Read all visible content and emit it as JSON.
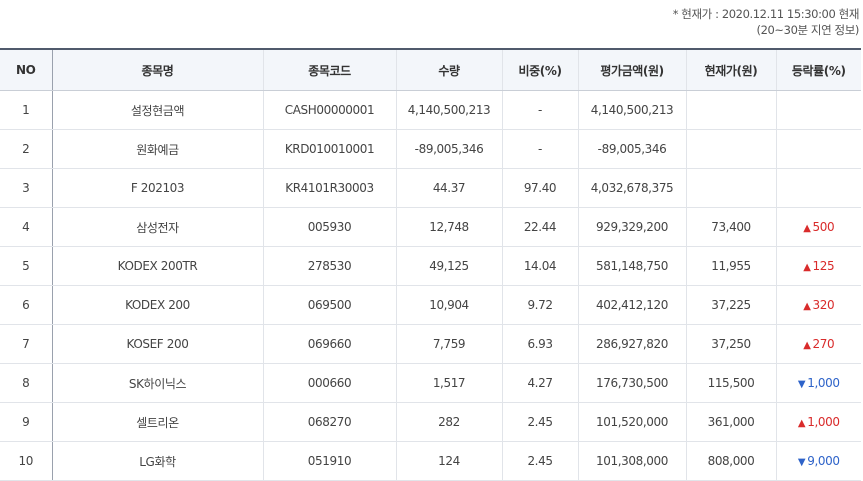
{
  "notice": {
    "line1": "* 현재가 : 2020.12.11 15:30:00 현재",
    "line2": "(20~30분 지연 정보)"
  },
  "columns": [
    "NO",
    "종목명",
    "종목코드",
    "수량",
    "비중(%)",
    "평가금액(원)",
    "현재가(원)",
    "등락률(%)"
  ],
  "rows": [
    {
      "no": "1",
      "name": "설정현금액",
      "code": "CASH00000001",
      "qty": "4,140,500,213",
      "weight": "-",
      "value": "4,140,500,213",
      "price": "",
      "change": "",
      "dir": ""
    },
    {
      "no": "2",
      "name": "원화예금",
      "code": "KRD010010001",
      "qty": "-89,005,346",
      "weight": "-",
      "value": "-89,005,346",
      "price": "",
      "change": "",
      "dir": ""
    },
    {
      "no": "3",
      "name": "F 202103",
      "code": "KR4101R30003",
      "qty": "44.37",
      "weight": "97.40",
      "value": "4,032,678,375",
      "price": "",
      "change": "",
      "dir": ""
    },
    {
      "no": "4",
      "name": "삼성전자",
      "code": "005930",
      "qty": "12,748",
      "weight": "22.44",
      "value": "929,329,200",
      "price": "73,400",
      "change": "500",
      "dir": "up"
    },
    {
      "no": "5",
      "name": "KODEX 200TR",
      "code": "278530",
      "qty": "49,125",
      "weight": "14.04",
      "value": "581,148,750",
      "price": "11,955",
      "change": "125",
      "dir": "up"
    },
    {
      "no": "6",
      "name": "KODEX 200",
      "code": "069500",
      "qty": "10,904",
      "weight": "9.72",
      "value": "402,412,120",
      "price": "37,225",
      "change": "320",
      "dir": "up"
    },
    {
      "no": "7",
      "name": "KOSEF 200",
      "code": "069660",
      "qty": "7,759",
      "weight": "6.93",
      "value": "286,927,820",
      "price": "37,250",
      "change": "270",
      "dir": "up"
    },
    {
      "no": "8",
      "name": "SK하이닉스",
      "code": "000660",
      "qty": "1,517",
      "weight": "4.27",
      "value": "176,730,500",
      "price": "115,500",
      "change": "1,000",
      "dir": "down"
    },
    {
      "no": "9",
      "name": "셀트리온",
      "code": "068270",
      "qty": "282",
      "weight": "2.45",
      "value": "101,520,000",
      "price": "361,000",
      "change": "1,000",
      "dir": "up"
    },
    {
      "no": "10",
      "name": "LG화학",
      "code": "051910",
      "qty": "124",
      "weight": "2.45",
      "value": "101,308,000",
      "price": "808,000",
      "change": "9,000",
      "dir": "down"
    }
  ],
  "icons": {
    "up": "triangle-up-icon",
    "down": "triangle-down-icon"
  },
  "colors": {
    "up": "#d92b2b",
    "down": "#2e63c9",
    "header_bg": "#f3f6fa",
    "header_border": "#505a6c"
  }
}
